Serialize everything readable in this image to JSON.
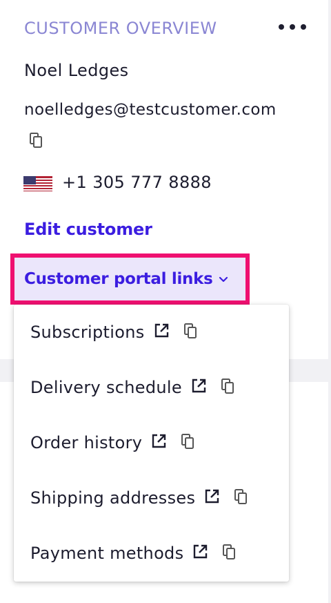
{
  "customer_overview": {
    "title": "CUSTOMER OVERVIEW",
    "name": "Noel Ledges",
    "email": "noelledges@testcustomer.com",
    "phone": "+1 305 777 8888",
    "phone_flag": "us-flag-icon",
    "edit_label": "Edit customer",
    "portal_links_label": "Customer portal links",
    "portal_links_expanded": true
  },
  "portal_menu": {
    "items": [
      {
        "label": "Subscriptions"
      },
      {
        "label": "Delivery schedule"
      },
      {
        "label": "Order history"
      },
      {
        "label": "Shipping addresses"
      },
      {
        "label": "Payment methods"
      }
    ],
    "item_icons": [
      "external-link-icon",
      "copy-icon"
    ]
  },
  "colors": {
    "title": "#8a86d3",
    "link": "#3b1de0",
    "highlight_border": "#ef1070",
    "highlight_fill": "#ebe6fb",
    "text": "#1c1c2e"
  }
}
